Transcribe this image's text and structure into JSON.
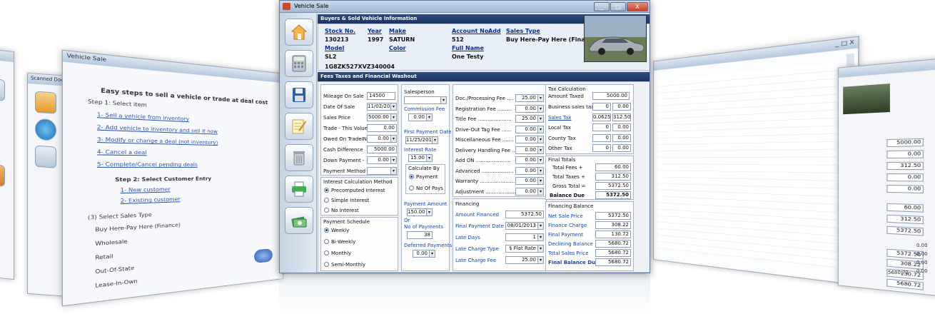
{
  "window": {
    "title": "Vehicle Sale",
    "minimize": "_",
    "maximize": "□",
    "close": "X"
  },
  "sections": {
    "buyers": "Buyers & Sold Vehicle Information",
    "fees": "Fees Taxes and Financial Washout"
  },
  "vehicle": {
    "stock_label": "Stock No.",
    "stock": "130213",
    "year_label": "Year",
    "year": "1997",
    "make_label": "Make",
    "make": "SATURN",
    "model_label": "Model",
    "model": "SL2",
    "color_label": "Color",
    "vin": "1G8ZK527XVZ340004",
    "account_label": "Account No.",
    "add_label": "Add",
    "account": "512",
    "fullname_label": "Full Name",
    "fullname": "One Testy",
    "saletype_label": "Sales Type",
    "saletype": "Buy Here-Pay Here (Finance)"
  },
  "left_fields": [
    {
      "label": "Mileage On Sale",
      "value": "14500"
    },
    {
      "label": "Date Of Sale",
      "value": "11/02/2012"
    },
    {
      "label": "Sales Price",
      "value": "5000.00"
    },
    {
      "label": "Trade - This Value",
      "value": "0.00"
    },
    {
      "label": "Owed On TradeIN",
      "value": "0.00"
    },
    {
      "label": "Cash Difference",
      "value": "5000.00"
    },
    {
      "label": "Down Payment -",
      "value": "0.00"
    },
    {
      "label": "Payment Method",
      "value": ""
    }
  ],
  "interest": {
    "title": "Interest Calculation Method",
    "options": [
      "Precomputed Interest",
      "Simple Interest",
      "No Interest"
    ],
    "selected": 0
  },
  "schedule": {
    "title": "Payment Schedule",
    "options": [
      "Weekly",
      "Bi-Weekly",
      "Monthly",
      "Semi-Monthly"
    ],
    "selected": 0
  },
  "middle": {
    "salesperson_label": "Salesperson",
    "commission_label": "Commission Fee",
    "commission": "0.00",
    "first_payment_label": "First Payment Date",
    "first_payment": "11/25/2012",
    "interest_rate_label": "Interest Rate",
    "interest_rate": "15.00",
    "calc_by_title": "Calculate By",
    "calc_options": [
      "Payment",
      "No Of Pays"
    ],
    "calc_selected": 0,
    "payment_amount_label": "Payment Amount",
    "payment_amount": "150.00",
    "or_label": "Or",
    "no_payments_label": "No of Payments",
    "no_payments": "38",
    "deferred_label": "Deferred Payments",
    "deferred": "0.00"
  },
  "fees": [
    {
      "label": "Doc./Processing Fee ....",
      "value": "25.00"
    },
    {
      "label": "Registration Fee .........",
      "value": "0.00"
    },
    {
      "label": "Title Fee .....................",
      "value": "25.00"
    },
    {
      "label": "Drive-Out Tag Fee ......",
      "value": "0.00"
    },
    {
      "label": "Miscellaneous Fee .......",
      "value": "0.00"
    },
    {
      "label": "Delivery Handling Fee ..",
      "value": "0.00"
    },
    {
      "label": "Add ON ......................",
      "value": "0.00"
    },
    {
      "label": "Advanced ....................",
      "value": "0.00"
    },
    {
      "label": "Warranty ......................",
      "value": "0.00"
    },
    {
      "label": "Adjustment ...................",
      "value": "0.00"
    }
  ],
  "financing": {
    "title": "Financing",
    "rows": [
      {
        "label": "Amount Financed",
        "value": "5372.50"
      },
      {
        "label": "Final Payment Date",
        "value": "08/01/2013"
      },
      {
        "label": "Late Days",
        "value": "1"
      },
      {
        "label": "Late Charge Type",
        "value": "$ Flat Rate"
      },
      {
        "label": "Late Charge Fee",
        "value": "25.00"
      }
    ]
  },
  "tax": {
    "title": "Tax Calculation",
    "amount_taxed_label": "Amount Taxed",
    "amount_taxed": "5000.00",
    "rows": [
      {
        "label": "Business sales tax",
        "rate": "0",
        "value": "0.00"
      },
      {
        "label": "Sales Tax",
        "rate": "0.0625",
        "value": "312.50"
      },
      {
        "label": "Local Tax",
        "rate": "0",
        "value": "0.00"
      },
      {
        "label": "County Tax",
        "rate": "0",
        "value": "0.00"
      },
      {
        "label": "Other Tax",
        "rate": "0",
        "value": "0.00"
      }
    ]
  },
  "totals": {
    "title": "Final Totals",
    "rows": [
      {
        "label": "Total Fees +",
        "value": "60.00"
      },
      {
        "label": "Total Taxes +",
        "value": "312.50"
      },
      {
        "label": "Gross Total =",
        "value": "5372.50"
      },
      {
        "label": "Balance Due",
        "value": "5372.50"
      }
    ]
  },
  "fin_balance": {
    "title": "Financing Balance",
    "rows": [
      {
        "label": "Net Sale Price",
        "value": "5372.50"
      },
      {
        "label": "Finance Charge",
        "value": "308.22"
      },
      {
        "label": "Final Payment",
        "value": "130.72"
      },
      {
        "label": "Declining Balance",
        "value": "5680.72"
      },
      {
        "label": "Total Sales Price",
        "value": "5680.72"
      },
      {
        "label": "Final Balance Due",
        "value": "5680.72"
      }
    ]
  },
  "left_panel": {
    "title": "Vehicle Sale",
    "heading": "Easy steps to sell a vehicle or trade at deal cost",
    "step1": "Step 1: Select item",
    "links": [
      "1- Sell a vehicle from inventory",
      "2- Add vehicle to inventory and sell it now",
      "3- Modify or change a deal (not inventory)",
      "4- Cancel a deal",
      "5- Complete/Cancel pending deals"
    ],
    "step2": "Step 2: Select Customer Entry",
    "cust_links": [
      "1- New customer",
      "2- Existing customer"
    ],
    "sale_type_title": "(3) Select Sales Type",
    "sale_types": [
      "Buy Here-Pay Here (Finance)",
      "Wholesale",
      "Retail",
      "Out-Of-State",
      "Lease-In-Own"
    ]
  },
  "scanned": {
    "title": "Scanned Documents"
  },
  "right_values": [
    "5000.00",
    "0.00",
    "312.50",
    "0.00",
    "0.00",
    "60.00",
    "312.50",
    "5372.50"
  ],
  "far_right_values": [
    "5372.50",
    "308.22",
    "130.72",
    "5680.72",
    "5680.72"
  ],
  "far_right_rates": [
    "0.00",
    "0.00",
    "0.00",
    "0.00"
  ]
}
